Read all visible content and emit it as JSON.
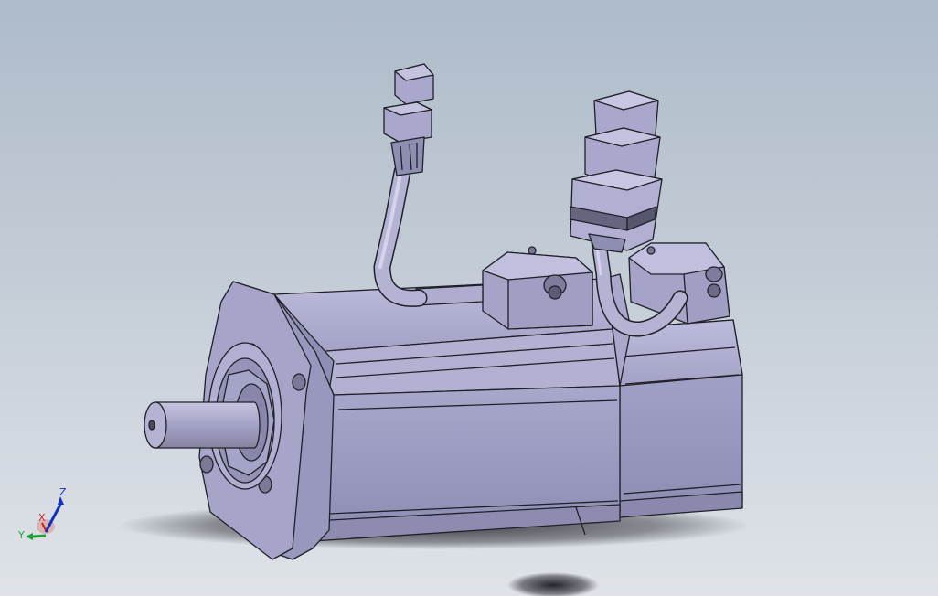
{
  "viewport": {
    "background_top": "#aebbca",
    "background_bottom": "#dfe3e8",
    "model_color": "#9c9bc0",
    "edge_color": "#202028"
  },
  "triad": {
    "x_label": "X",
    "y_label": "Y",
    "z_label": "Z",
    "x_color": "#d02020",
    "y_color": "#20a030",
    "z_color": "#1030c0"
  }
}
